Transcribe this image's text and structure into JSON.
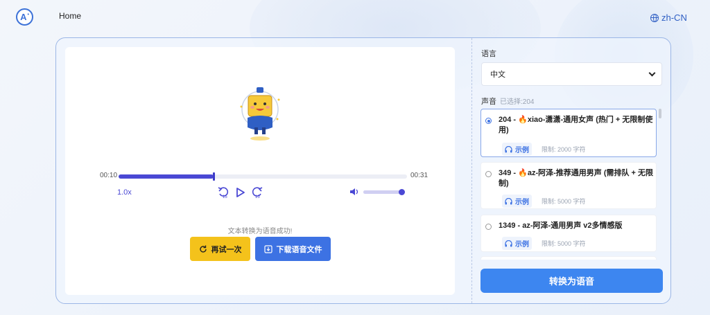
{
  "header": {
    "logo_text": "A",
    "home_label": "Home",
    "locale_label": "zh-CN"
  },
  "player": {
    "current_time": "00:10",
    "duration": "00:31",
    "progress_fraction": 0.33,
    "volume_fraction": 0.95,
    "speed_label": "1.0x",
    "rewind_label": "15",
    "forward_label": "15"
  },
  "result": {
    "success_message": "文本转换为语音成功!",
    "retry_label": "再试一次",
    "download_label": "下载语音文件"
  },
  "settings": {
    "language_label": "语言",
    "language_value": "中文",
    "voice_label": "声音",
    "voice_selected_count": "已选择:204",
    "voices": [
      {
        "id": "204",
        "name": "204 - 🔥xiao-潇潇-通用女声 (热门 + 无限制使用)",
        "sample_label": "示例",
        "limit": "限制: 2000 字符",
        "selected": true
      },
      {
        "id": "349",
        "name": "349 - 🔥az-阿泽-推荐通用男声 (需排队 + 无限制)",
        "sample_label": "示例",
        "limit": "限制: 5000 字符",
        "selected": false
      },
      {
        "id": "1349",
        "name": "1349 - az-阿泽-通用男声 v2多情感版",
        "sample_label": "示例",
        "limit": "限制: 5000 字符",
        "selected": false
      }
    ],
    "convert_label": "转换为语音"
  },
  "colors": {
    "accent": "#3d72e3",
    "progress": "#4a48d4",
    "retry": "#f4c21b"
  }
}
